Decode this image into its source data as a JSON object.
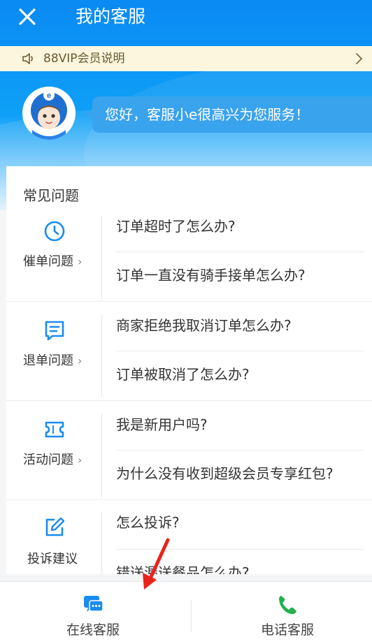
{
  "header": {
    "title": "我的客服",
    "close_icon": "close-icon"
  },
  "notice": {
    "text": "88VIP会员说明",
    "icon": "speaker-icon"
  },
  "greeting": {
    "text": "您好，客服小e很高兴为您服务！"
  },
  "faq": {
    "title": "常见问题",
    "sections": [
      {
        "label": "催单问题",
        "icon": "clock-icon",
        "questions": [
          "订单超时了怎么办?",
          "订单一直没有骑手接单怎么办?"
        ]
      },
      {
        "label": "退单问题",
        "icon": "document-icon",
        "questions": [
          "商家拒绝我取消订单怎么办?",
          "订单被取消了怎么办?"
        ]
      },
      {
        "label": "活动问题",
        "icon": "ticket-icon",
        "questions": [
          "我是新用户吗?",
          "为什么没有收到超级会员专享红包?"
        ]
      },
      {
        "label": "投诉建议",
        "icon": "edit-icon",
        "questions": [
          "怎么投诉?",
          "错送漏送餐品怎么办?"
        ]
      }
    ]
  },
  "bottom_tabs": [
    {
      "label": "在线客服",
      "icon": "chat-icon",
      "color": "#1a8cf0"
    },
    {
      "label": "电话客服",
      "icon": "phone-icon",
      "color": "#22b14c"
    }
  ],
  "colors": {
    "primary": "#0a8af3",
    "accent_red": "#e8231c"
  }
}
